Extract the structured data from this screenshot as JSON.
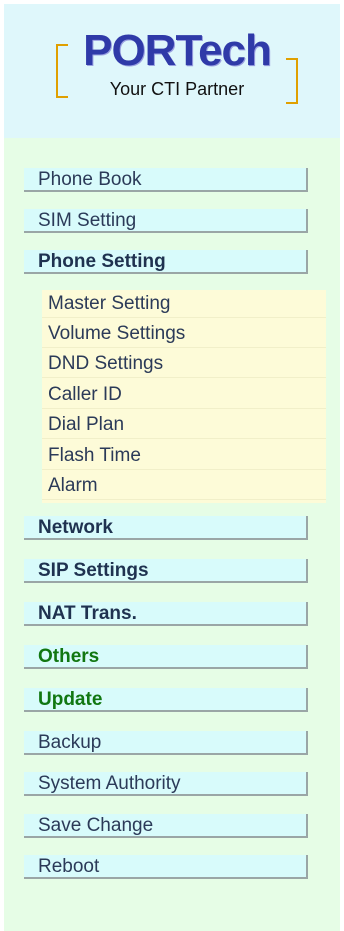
{
  "logo": {
    "title": "PORTech",
    "tagline": "Your CTI Partner"
  },
  "menu": {
    "phone_book": "Phone Book",
    "sim_setting": "SIM Setting",
    "phone_setting": "Phone Setting",
    "network": "Network",
    "sip_settings": "SIP Settings",
    "nat_trans": "NAT Trans.",
    "others": "Others",
    "update": "Update",
    "backup": "Backup",
    "system_authority": "System Authority",
    "save_change": "Save Change",
    "reboot": "Reboot"
  },
  "submenu": {
    "items": [
      "Master Setting",
      "Volume Settings",
      "DND Settings",
      "Caller ID",
      "Dial Plan",
      "Flash Time",
      "Alarm"
    ]
  },
  "colors": {
    "sidebar_bg": "#e6fde6",
    "logo_bg": "#dff7fb",
    "button_bg": "#d8fbfb",
    "submenu_bg": "#fdfbd8",
    "accent_green": "#117711"
  }
}
